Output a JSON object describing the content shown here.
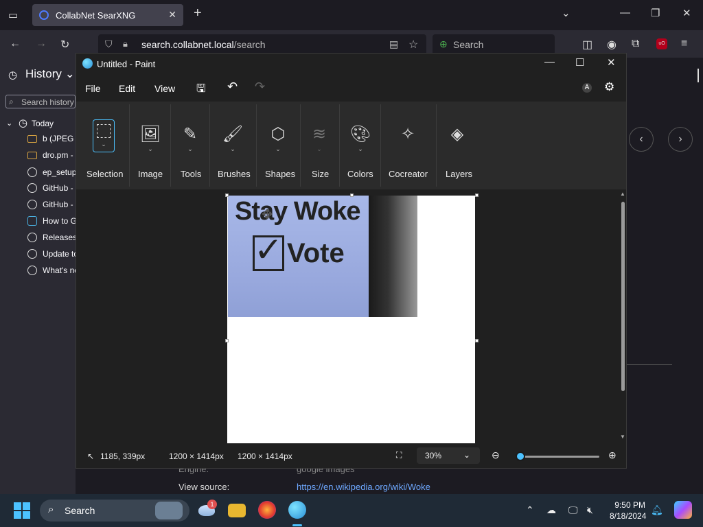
{
  "browser": {
    "tab_title": "CollabNet SearXNG",
    "url_host": "search.collabnet.local",
    "url_path": "/search",
    "search_placeholder": "Search"
  },
  "sidebar": {
    "title": "History",
    "search_placeholder": "Search history",
    "group": "Today",
    "items": [
      {
        "label": "b (JPEG Ir",
        "icon": "folder-icon"
      },
      {
        "label": "dro.pm -",
        "icon": "folder-icon"
      },
      {
        "label": "ep_setup",
        "icon": "globe-icon"
      },
      {
        "label": "GitHub -",
        "icon": "github-icon"
      },
      {
        "label": "GitHub -",
        "icon": "github-icon"
      },
      {
        "label": "How to G",
        "icon": "page-icon"
      },
      {
        "label": "Releases",
        "icon": "github-icon"
      },
      {
        "label": "Update to",
        "icon": "github-icon"
      },
      {
        "label": "What's ne",
        "icon": "globe-icon"
      }
    ]
  },
  "page": {
    "engine_label": "Engine:",
    "engine_value": "google images",
    "source_label": "View source:",
    "source_value": "https://en.wikipedia.org/wiki/Woke"
  },
  "paint": {
    "title": "Untitled - Paint",
    "menus": [
      "File",
      "Edit",
      "View"
    ],
    "tools": [
      "Selection",
      "Image",
      "Tools",
      "Brushes",
      "Shapes",
      "Size",
      "Colors",
      "Cocreator",
      "Layers"
    ],
    "image_text_1": "Stay Woke",
    "image_text_2": "Vote",
    "status": {
      "cursor": "1185, 339px",
      "selection_size": "1200 × 1414px",
      "canvas_size": "1200 × 1414px",
      "zoom": "30%"
    },
    "zoom_slider_fraction": 0.0
  },
  "taskbar": {
    "search_label": "Search",
    "time": "9:50 PM",
    "date": "8/18/2024",
    "weather_badge": "1"
  },
  "colors": {
    "accent": "#4cc2ff",
    "paint_bg": "#202020",
    "ribbon_bg": "#2b2b2b"
  }
}
